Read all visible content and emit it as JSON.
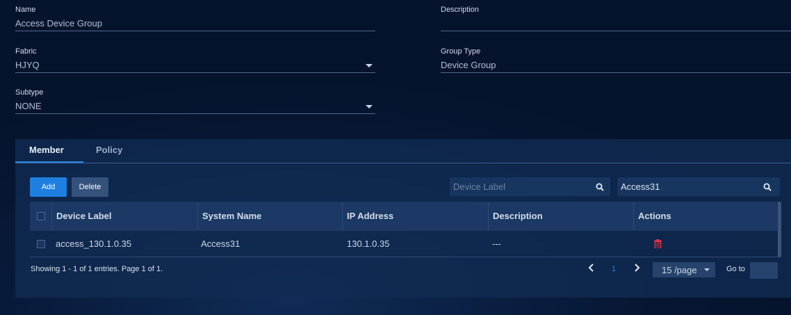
{
  "form": {
    "name": {
      "label": "Name",
      "value": "Access Device Group"
    },
    "description": {
      "label": "Description",
      "value": ""
    },
    "fabric": {
      "label": "Fabric",
      "value": "HJYQ"
    },
    "group_type": {
      "label": "Group Type",
      "value": "Device Group"
    },
    "subtype": {
      "label": "Subtype",
      "value": "NONE"
    }
  },
  "tabs": [
    {
      "label": "Member",
      "active": true
    },
    {
      "label": "Policy",
      "active": false
    }
  ],
  "toolbar": {
    "add_label": "Add",
    "delete_label": "Delete"
  },
  "search": {
    "device_label_placeholder": "Device Label",
    "device_label_value": "",
    "system_name_value": "Access31"
  },
  "table": {
    "columns": [
      "Device Label",
      "System Name",
      "IP Address",
      "Description",
      "Actions"
    ],
    "rows": [
      {
        "device_label": "access_130.1.0.35",
        "system_name": "Access31",
        "ip_address": "130.1.0.35",
        "description": "---",
        "action_icon": "trash-icon"
      }
    ]
  },
  "pagination": {
    "summary": "Showing 1 - 1 of 1 entries. Page 1 of 1.",
    "current_page": "1",
    "page_size": "15 /page",
    "goto_label": "Go to",
    "goto_value": ""
  },
  "colors": {
    "accent": "#1e7fe0",
    "danger": "#e8334a",
    "background": "#071632"
  }
}
